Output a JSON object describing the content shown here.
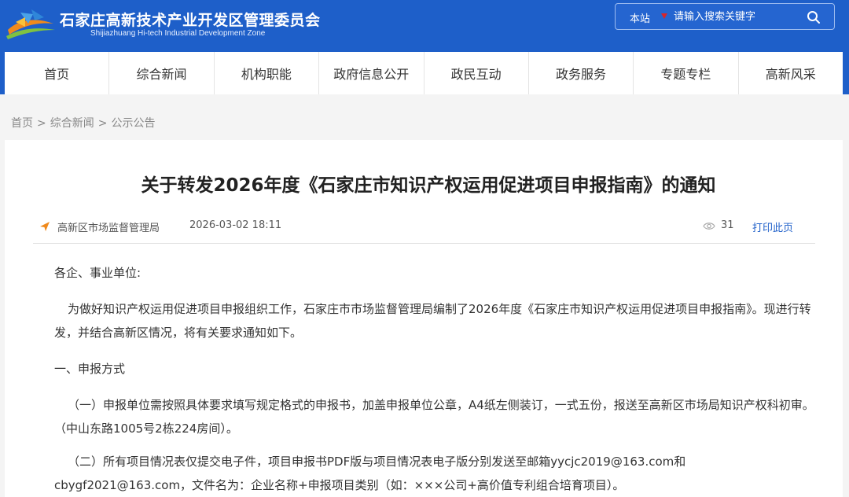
{
  "header": {
    "site_title": "石家庄高新技术产业开发区管理委员会",
    "site_subtitle": "Shijiazhuang Hi-tech Industrial Development Zone",
    "search": {
      "scope": "本站",
      "placeholder": "请输入搜索关键字"
    }
  },
  "nav": {
    "items": [
      "首页",
      "综合新闻",
      "机构职能",
      "政府信息公开",
      "政民互动",
      "政务服务",
      "专题专栏",
      "高新风采"
    ]
  },
  "breadcrumb": {
    "items": [
      "首页",
      "综合新闻",
      "公示公告"
    ],
    "separator": ">"
  },
  "article": {
    "title": "关于转发2026年度《石家庄市知识产权运用促进项目申报指南》的通知",
    "source": "高新区市场监督管理局",
    "date": "2026-03-02 18:11",
    "views": "31",
    "print_label": "打印此页",
    "paragraphs": [
      "各企、事业单位:",
      "为做好知识产权运用促进项目申报组织工作，石家庄市市场监督管理局编制了2026年度《石家庄市知识产权运用促进项目申报指南》。现进行转发，并结合高新区情况，将有关要求通知如下。",
      "一、申报方式",
      "（一）申报单位需按照具体要求填写规定格式的申报书，加盖申报单位公章，A4纸左侧装订，一式五份，报送至高新区市场局知识产权科初审。（中山东路1005号2栋224房间）。",
      "（二）所有项目情况表仅提交电子件，项目申报书PDF版与项目情况表电子版分别发送至邮箱yycjc2019@163.com和cbygf2021@163.com，文件名为：企业名称+申报项目类别（如：×××公司+高价值专利组合培育项目）。"
    ]
  },
  "colors": {
    "brand_blue": "#1e5fc9",
    "caret_red": "#d9252a",
    "page_bg": "#f4f4f4"
  }
}
